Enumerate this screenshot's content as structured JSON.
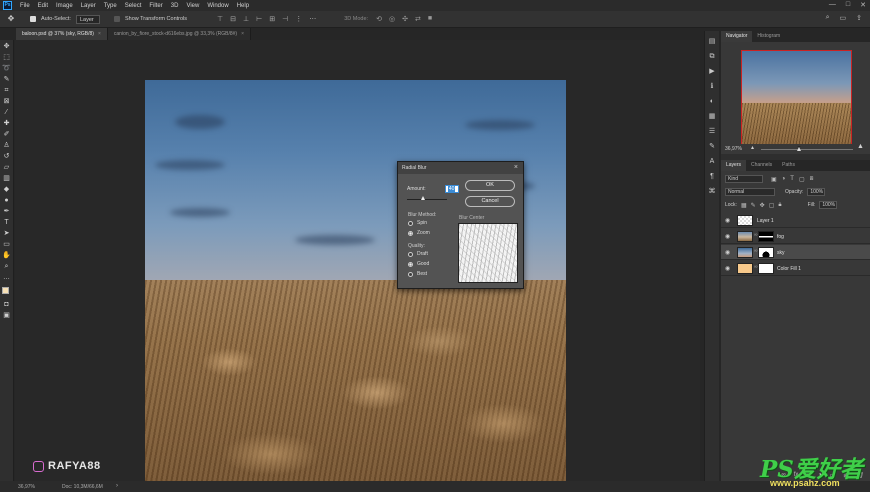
{
  "menubar": {
    "logo": "Ps",
    "items": [
      "File",
      "Edit",
      "Image",
      "Layer",
      "Type",
      "Select",
      "Filter",
      "3D",
      "View",
      "Window",
      "Help"
    ],
    "window_controls": [
      "—",
      "□",
      "✕"
    ]
  },
  "options": {
    "auto_select_label": "Auto-Select:",
    "auto_select_value": "Layer",
    "transform_label": "Show Transform Controls",
    "mode_3d": "3D Mode:"
  },
  "tabs": [
    {
      "label": "baloon.psd @ 37% (sky, RGB/8)",
      "active": true
    },
    {
      "label": "canion_by_fiore_stock-d616ebs.jpg @ 33,3% (RGB/8#)",
      "active": false
    }
  ],
  "dialog": {
    "title": "Radial Blur",
    "amount_label": "Amount:",
    "amount_value": "40",
    "ok_label": "OK",
    "cancel_label": "Cancel",
    "blur_method_label": "Blur Method:",
    "spin_label": "Spin",
    "zoom_label": "Zoom",
    "quality_label": "Quality:",
    "draft_label": "Draft",
    "good_label": "Good",
    "best_label": "Best",
    "blur_center_label": "Blur Center",
    "selected_method": "Zoom",
    "selected_quality": "Good"
  },
  "navigator": {
    "tabs": [
      "Navigator",
      "Histogram"
    ],
    "zoom": "36,97%"
  },
  "layers_panel": {
    "tabs": [
      "Layers",
      "Channels",
      "Paths"
    ],
    "kind": "Kind",
    "blend_mode": "Normal",
    "opacity_label": "Opacity:",
    "opacity_value": "100%",
    "lock_label": "Lock:",
    "fill_label": "Fill:",
    "fill_value": "100%",
    "layers": [
      {
        "name": "Layer 1",
        "selected": false
      },
      {
        "name": "fog",
        "selected": false
      },
      {
        "name": "sky",
        "selected": true
      },
      {
        "name": "Color Fill 1",
        "selected": false
      }
    ]
  },
  "status": {
    "zoom": "36,97%",
    "doc": "Doc: 10,3M/66,6M"
  },
  "watermarks": {
    "instagram": "RAFYA88",
    "site_main": "PS爱好者",
    "site_url": "www.psahz.com"
  },
  "colors": {
    "accent": "#31a8ff",
    "foreground_swatch": "#f7e1b6",
    "background_swatch": "#ffffff"
  }
}
